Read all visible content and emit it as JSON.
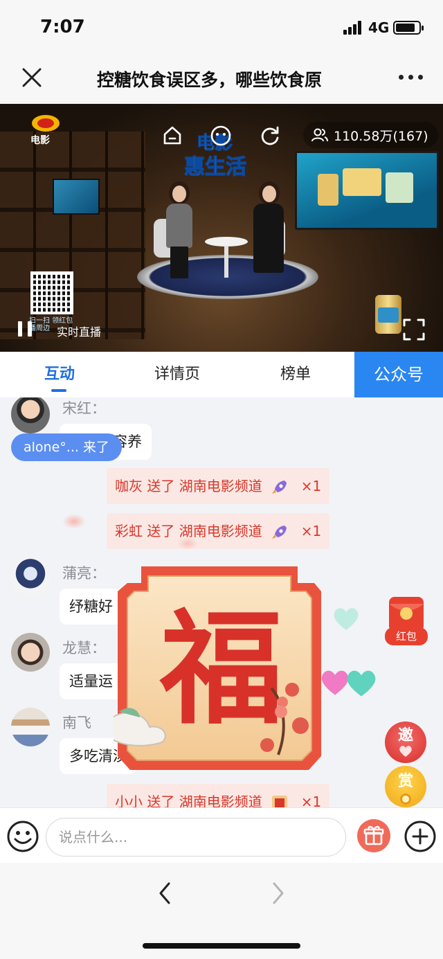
{
  "status_bar": {
    "time": "7:07",
    "network": "4G",
    "battery_level": 0.85
  },
  "nav": {
    "title": "控糖饮食误区多，哪些饮食原",
    "close_icon": "close-icon",
    "more_icon": "more-icon"
  },
  "video": {
    "channel_logo_text": "电影",
    "show_title_line1": "电影",
    "show_title_line2": "惠生活",
    "viewers": "110.58万(167)",
    "live_label": "实时直播",
    "qr_caption": "扫一扫 领红包 播周边"
  },
  "tabs": {
    "items": [
      {
        "label": "互动",
        "active": true
      },
      {
        "label": "详情页",
        "active": false
      },
      {
        "label": "榜单",
        "active": false
      }
    ],
    "official_label": "公众号"
  },
  "chat": {
    "join_notice": "alone°... 来了",
    "messages": [
      {
        "user": "宋红：",
        "text": "内外兼容养"
      },
      {
        "user": "蒲亮：",
        "text": "纾糖好"
      },
      {
        "user": "龙慧：",
        "text": "适量运"
      },
      {
        "user": "南飞",
        "text": "多吃清淡"
      }
    ],
    "gifts": [
      {
        "text": "咖灰 送了 湖南电影频道",
        "icon": "rocket-icon",
        "count": "×1"
      },
      {
        "text": "彩虹 送了 湖南电影频道",
        "icon": "rocket-icon",
        "count": "×1"
      },
      {
        "text": "小小 送了 湖南电影频道",
        "icon": "fu-icon",
        "count": "×1"
      }
    ]
  },
  "overlay": {
    "fu_char": "福",
    "red_packet_label": "红包",
    "invite_label": "邀",
    "reward_label": "赏"
  },
  "input": {
    "placeholder": "说点什么..."
  },
  "colors": {
    "accent_blue": "#1d6fe0",
    "official_blue": "#2a86f0",
    "gift_red": "#d9372b",
    "gift_bg": "#fbe8e4"
  }
}
